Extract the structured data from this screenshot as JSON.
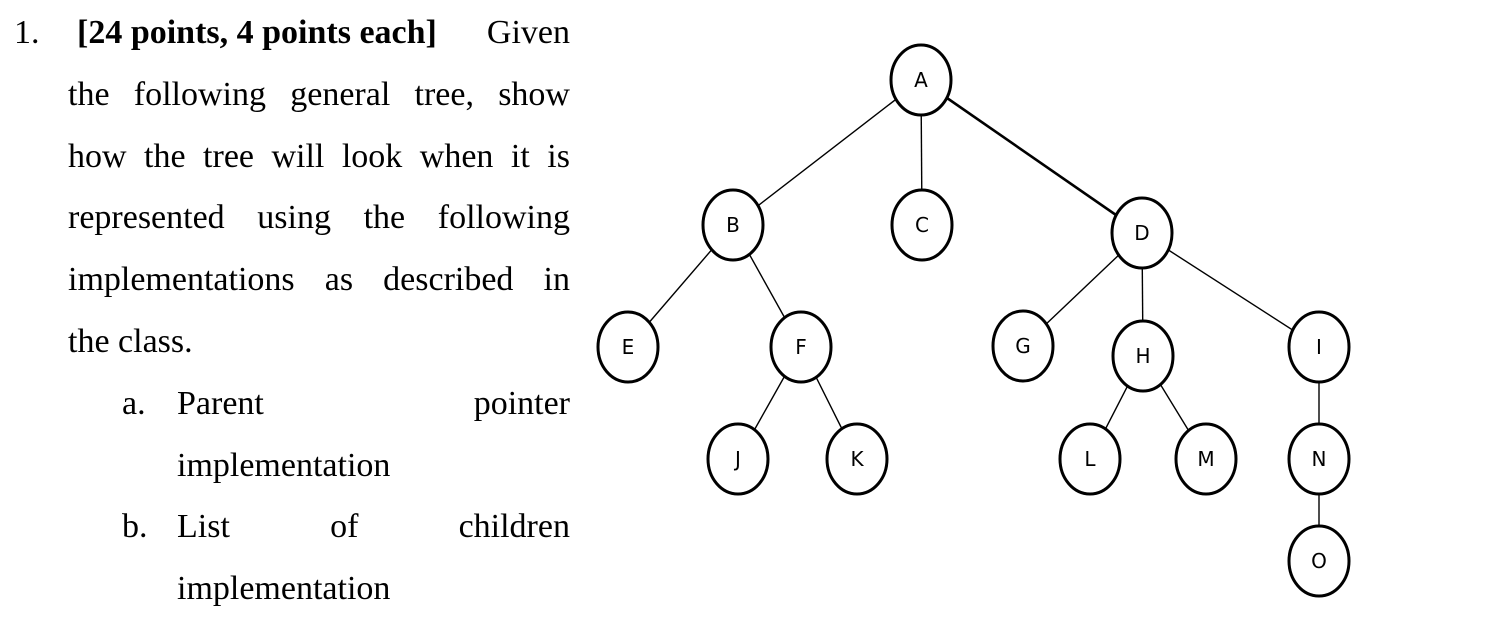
{
  "question": {
    "number": "1.",
    "points": "[24 points, 4 points each]",
    "lines": [
      "Given",
      "the following general tree, show",
      "how the tree will look when it is",
      "represented using the following",
      "implementations as described in",
      "the class."
    ],
    "items": [
      {
        "marker": "a.",
        "words": [
          "Parent",
          "pointer"
        ],
        "continuation": "implementation"
      },
      {
        "marker": "b.",
        "words": [
          "List",
          "of",
          "children"
        ],
        "continuation": "implementation"
      }
    ]
  },
  "tree": {
    "nodes": [
      "A",
      "B",
      "C",
      "D",
      "E",
      "F",
      "G",
      "H",
      "I",
      "J",
      "K",
      "L",
      "M",
      "N",
      "O"
    ],
    "edges": [
      [
        "A",
        "B"
      ],
      [
        "A",
        "C"
      ],
      [
        "A",
        "D"
      ],
      [
        "B",
        "E"
      ],
      [
        "B",
        "F"
      ],
      [
        "F",
        "J"
      ],
      [
        "F",
        "K"
      ],
      [
        "D",
        "G"
      ],
      [
        "D",
        "H"
      ],
      [
        "D",
        "I"
      ],
      [
        "H",
        "L"
      ],
      [
        "H",
        "M"
      ],
      [
        "I",
        "N"
      ],
      [
        "N",
        "O"
      ]
    ]
  }
}
